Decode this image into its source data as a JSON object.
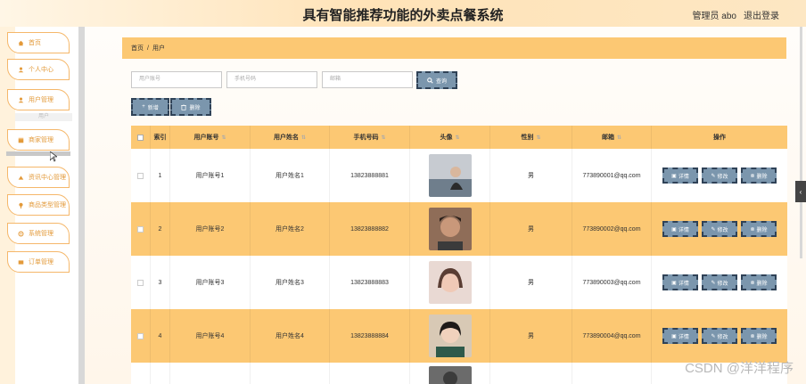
{
  "header": {
    "title": "具有智能推荐功能的外卖点餐系统",
    "admin_label": "管理员 abo",
    "logout_label": "退出登录"
  },
  "sidebar": {
    "items": [
      {
        "label": "首页",
        "icon": "home-icon"
      },
      {
        "label": "个人中心",
        "icon": "person-icon"
      },
      {
        "label": "用户管理",
        "icon": "user-icon"
      },
      {
        "label": "商家管理",
        "icon": "shop-icon"
      },
      {
        "label": "资讯中心管理",
        "icon": "news-icon"
      },
      {
        "label": "商品类型管理",
        "icon": "tag-icon"
      },
      {
        "label": "系统管理",
        "icon": "settings-icon"
      },
      {
        "label": "订单管理",
        "icon": "order-icon"
      }
    ],
    "sub_item": "用户"
  },
  "breadcrumb": {
    "home": "首页",
    "sep": "/",
    "current": "用户"
  },
  "search": {
    "account_placeholder": "用户账号",
    "phone_placeholder": "手机号码",
    "email_placeholder": "邮箱",
    "search_label": "查询"
  },
  "toolbar": {
    "add_label": "新增",
    "delete_label": "删除"
  },
  "table": {
    "headers": {
      "index": "索引",
      "account": "用户账号",
      "name": "用户姓名",
      "phone": "手机号码",
      "avatar": "头像",
      "sex": "性别",
      "email": "邮箱",
      "ops": "操作"
    },
    "rows": [
      {
        "index": "1",
        "account": "用户账号1",
        "name": "用户姓名1",
        "phone": "13823888881",
        "sex": "男",
        "email": "773890001@qq.com"
      },
      {
        "index": "2",
        "account": "用户账号2",
        "name": "用户姓名2",
        "phone": "13823888882",
        "sex": "男",
        "email": "773890002@qq.com"
      },
      {
        "index": "3",
        "account": "用户账号3",
        "name": "用户姓名3",
        "phone": "13823888883",
        "sex": "男",
        "email": "773890003@qq.com"
      },
      {
        "index": "4",
        "account": "用户账号4",
        "name": "用户姓名4",
        "phone": "13823888884",
        "sex": "男",
        "email": "773890004@qq.com"
      }
    ],
    "ops": {
      "detail": "详情",
      "edit": "修改",
      "delete": "删除"
    }
  },
  "watermark": "CSDN @洋洋程序",
  "colors": {
    "accent": "#fcc873",
    "sidebar_border": "#f5b76a",
    "button": "#7b96ad"
  }
}
